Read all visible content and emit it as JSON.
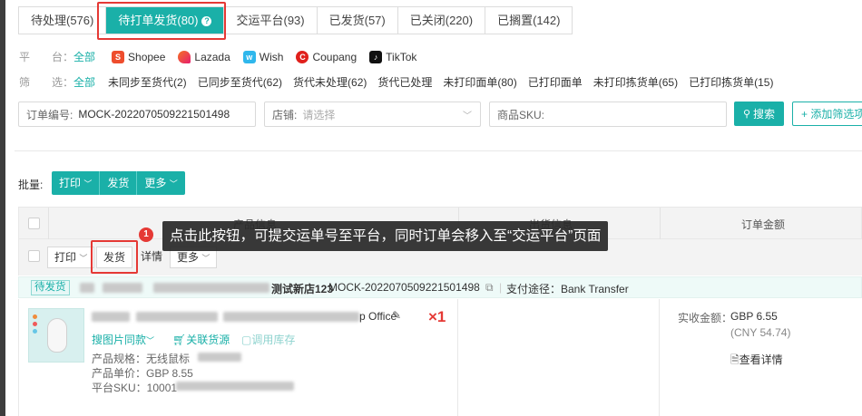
{
  "tabs": [
    {
      "label": "待处理(576)"
    },
    {
      "label": "待打单发货(80)"
    },
    {
      "label": "交运平台(93)"
    },
    {
      "label": "已发货(57)"
    },
    {
      "label": "已关闭(220)"
    },
    {
      "label": "已搁置(142)"
    }
  ],
  "help_icon_glyph": "?",
  "platform_filter": {
    "label": "平　　台：",
    "all": "全部",
    "platforms": [
      {
        "name": "Shopee",
        "icon": "shopee-bag-icon",
        "color": "#ee4d2d"
      },
      {
        "name": "Lazada",
        "icon": "lazada-heart-icon",
        "color": "#f57224"
      },
      {
        "name": "Wish",
        "icon": "wish-logo-icon",
        "color": "#2fb7ec"
      },
      {
        "name": "Coupang",
        "icon": "coupang-logo-icon",
        "color": "#e0201c"
      },
      {
        "name": "TikTok",
        "icon": "tiktok-logo-icon",
        "color": "#111111"
      }
    ]
  },
  "status_filter": {
    "label": "筛　　选：",
    "all": "全部",
    "options": [
      "未同步至货代(2)",
      "已同步至货代(62)",
      "货代未处理(62)",
      "货代已处理",
      "未打印面单(80)",
      "已打印面单",
      "未打印拣货单(65)",
      "已打印拣货单(15)"
    ]
  },
  "search": {
    "order_label": "订单编号:",
    "order_value": "MOCK-2022070509221501498",
    "store_label": "店铺:",
    "store_placeholder": "请选择",
    "sku_label": "商品SKU:",
    "search_button": "搜索",
    "add_filter_button": "+ 添加筛选项"
  },
  "batch": {
    "label": "批量:",
    "print": "打印",
    "ship": "发货",
    "more": "更多"
  },
  "table": {
    "col_product": "产品信息",
    "col_shipping": "出货信息",
    "col_amount": "订单金额"
  },
  "row_actions": {
    "print": "打印",
    "ship": "发货",
    "detail": "详情",
    "more": "更多"
  },
  "tooltip": {
    "step": "1",
    "text": "点击此按钮，可提交运单号至平台，同时订单会移入至“交运平台”页面"
  },
  "order": {
    "status": "待发货",
    "store_suffix": "测试新店123",
    "order_no": "MOCK-2022070509221501498",
    "payment": "支付途径：Bank Transfer"
  },
  "product": {
    "title_suffix": "p Office",
    "quantity": "×1",
    "link_image_search": "搜图片同款",
    "link_source": "关联货源",
    "link_stock": "调用库存",
    "spec_label": "产品规格：无线鼠标",
    "price_label": "产品单价：GBP 8.55",
    "sku_label": "平台SKU：10001"
  },
  "amount": {
    "received_label": "实收金额：",
    "received_value": "GBP 6.55",
    "cny": "(CNY 54.74)",
    "detail_link": "查看详情"
  },
  "colors": {
    "accent": "#1ab0a8",
    "highlight": "#e53935"
  }
}
